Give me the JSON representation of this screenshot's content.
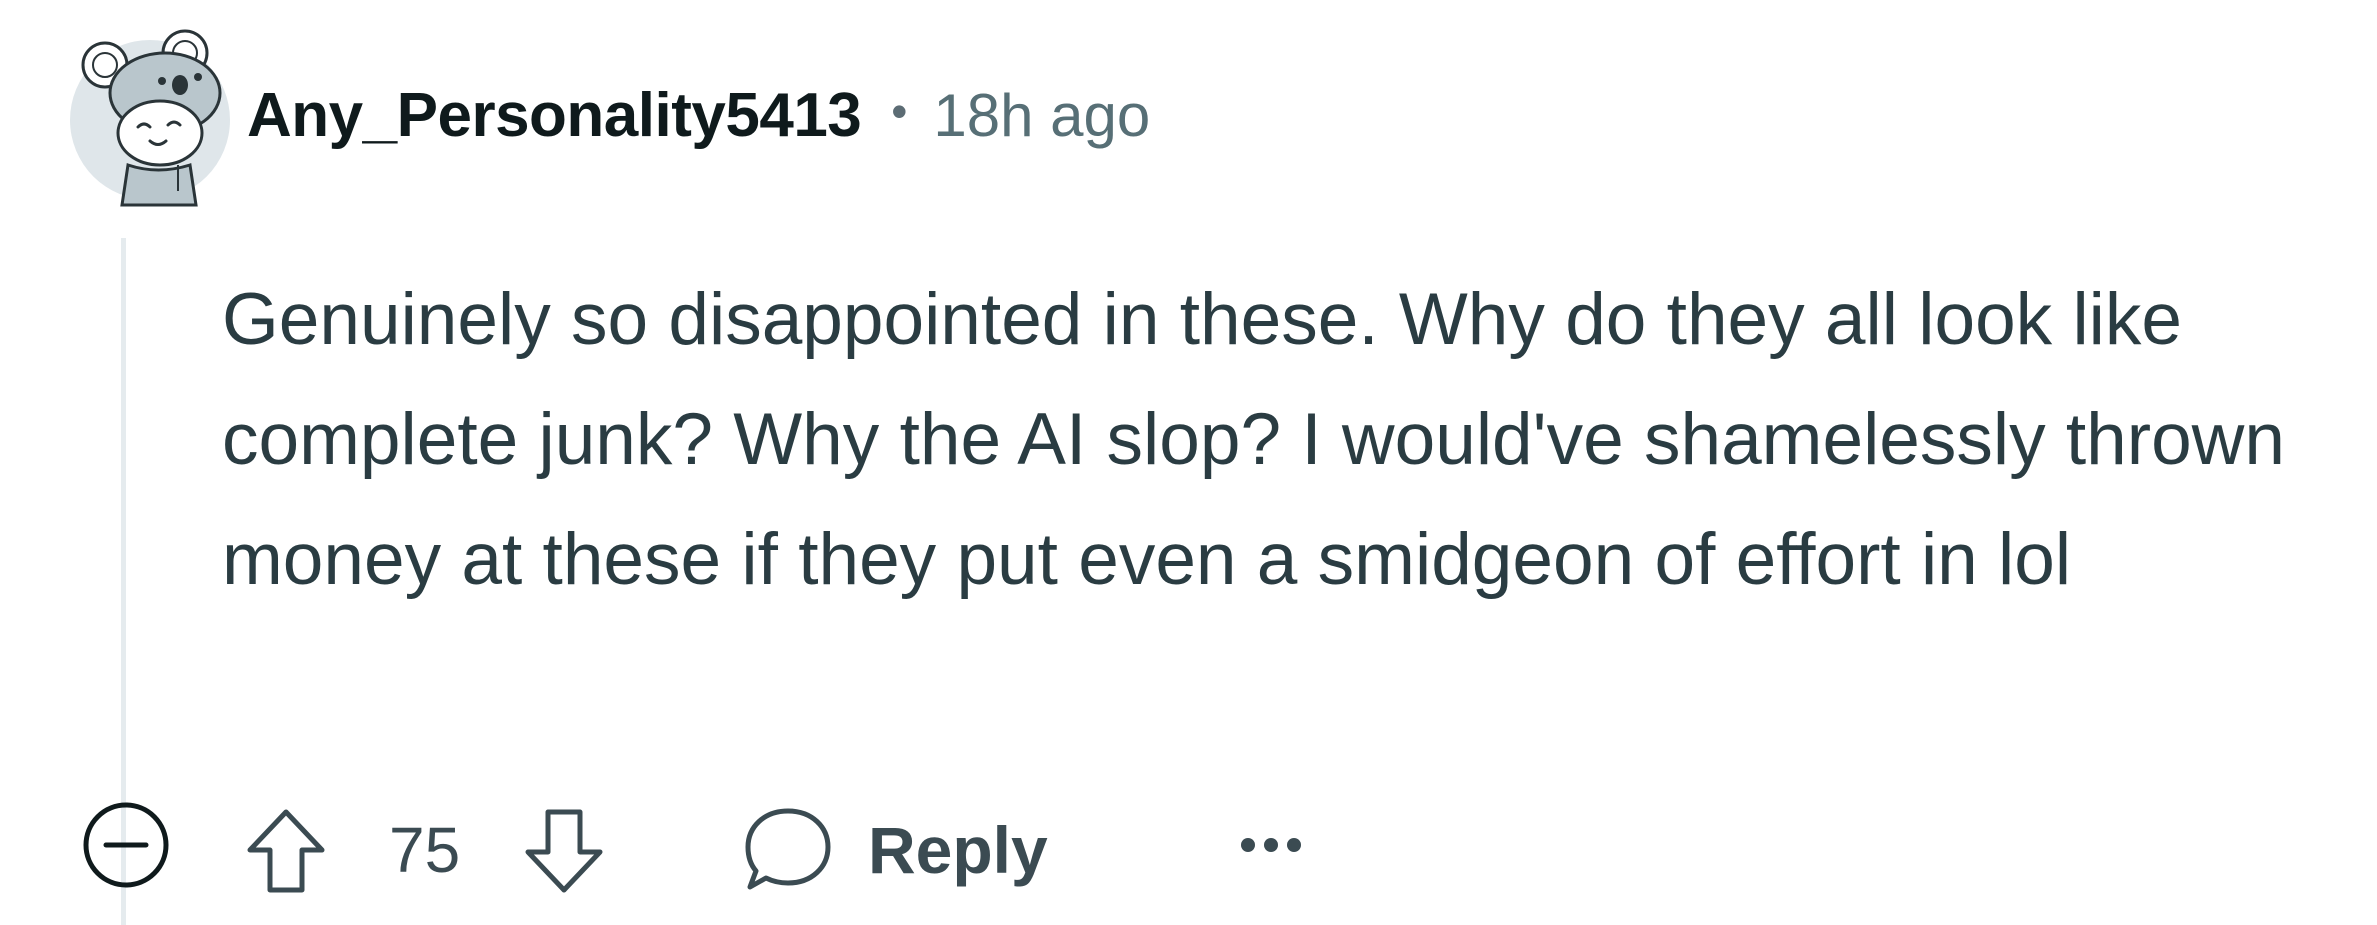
{
  "comment": {
    "author": "Any_Personality5413",
    "separator": "•",
    "timestamp": "18h ago",
    "body": "Genuinely so disappointed in these. Why do they all look like complete junk? Why the AI slop? I would've shamelessly thrown money at these if they put even a smidgeon of effort in lol",
    "score": "75",
    "reply_label": "Reply",
    "avatar_icon": "koala-snoo-avatar"
  },
  "actions": {
    "collapse_icon": "collapse-minus-icon",
    "upvote_icon": "upvote-arrow-icon",
    "downvote_icon": "downvote-arrow-icon",
    "reply_icon": "speech-bubble-icon",
    "more_icon": "more-dots-icon"
  },
  "colors": {
    "text_primary": "#0f1a1c",
    "text_secondary": "#576f76",
    "thread_line": "#e5ebee"
  }
}
